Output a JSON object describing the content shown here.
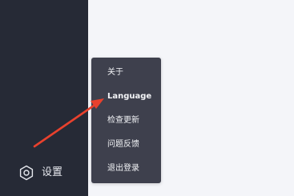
{
  "sidebar": {
    "settings": {
      "icon": "settings-hexagon-icon",
      "label": "设置"
    }
  },
  "menu": {
    "items": [
      {
        "label": "关于"
      },
      {
        "label": "Language"
      },
      {
        "label": "检查更新"
      },
      {
        "label": "问题反馈"
      },
      {
        "label": "退出登录"
      }
    ]
  },
  "annotation": {
    "arrow_color": "#e8412d"
  },
  "colors": {
    "sidebar_bg": "#262a36",
    "menu_bg": "#3e404d",
    "content_bg": "#f4f5f9"
  }
}
